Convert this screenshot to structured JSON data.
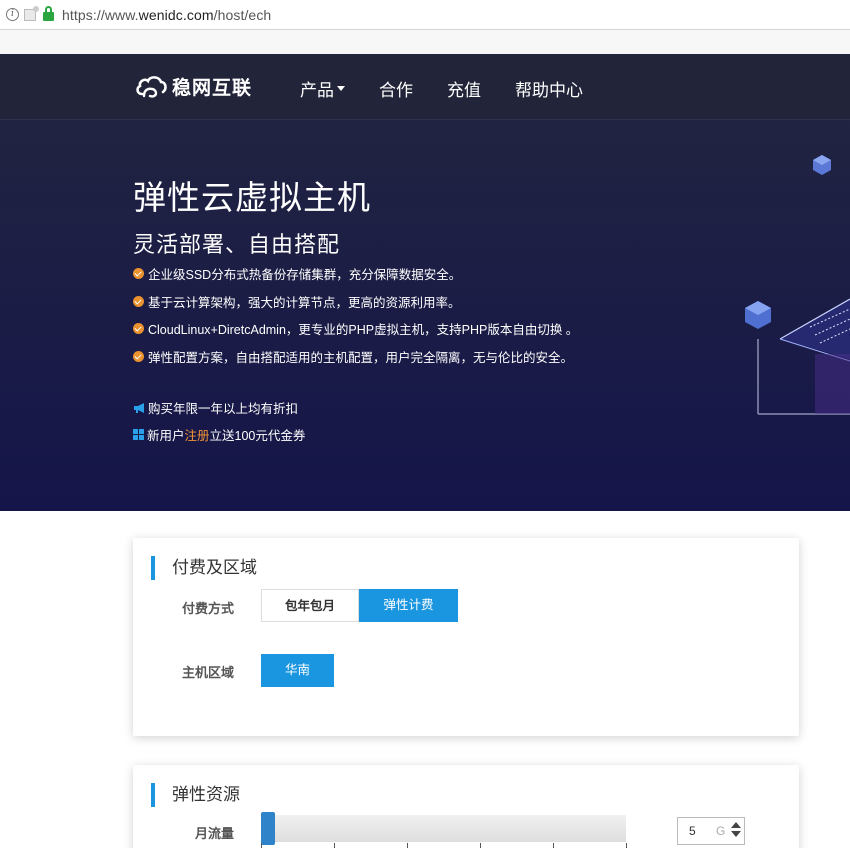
{
  "browser": {
    "url_prefix": "https://www.",
    "url_host": "wenidc.com",
    "url_path": "/host/ech"
  },
  "header": {
    "logo_text": "稳网互联",
    "nav": [
      {
        "label": "产品",
        "has_dropdown": true
      },
      {
        "label": "合作"
      },
      {
        "label": "充值"
      },
      {
        "label": "帮助中心"
      }
    ]
  },
  "hero": {
    "title": "弹性云虚拟主机",
    "subtitle": "灵活部署、自由搭配",
    "features": [
      "企业级SSD分布式热备份存储集群，充分保障数据安全。",
      "基于云计算架构，强大的计算节点，更高的资源利用率。",
      "CloudLinux+DiretcAdmin，更专业的PHP虚拟主机，支持PHP版本自由切换 。",
      "弹性配置方案，自由搭配适用的主机配置，用户完全隔离，无与伦比的安全。"
    ],
    "promo1": "购买年限一年以上均有折扣",
    "promo2_before": "新用户",
    "promo2_highlight": "注册",
    "promo2_after": "立送100元代金券"
  },
  "billing_card": {
    "title": "付费及区域",
    "payment_label": "付费方式",
    "payment_options": [
      "包年包月",
      "弹性计费"
    ],
    "payment_selected": "弹性计费",
    "region_label": "主机区域",
    "region_options": [
      "华南"
    ],
    "region_selected": "华南"
  },
  "resource_card": {
    "title": "弹性资源",
    "traffic_label": "月流量",
    "traffic_value": "5",
    "traffic_unit": "G"
  },
  "colors": {
    "accent": "#1a96e0",
    "highlight": "#f29437",
    "check": "#e9922f"
  }
}
